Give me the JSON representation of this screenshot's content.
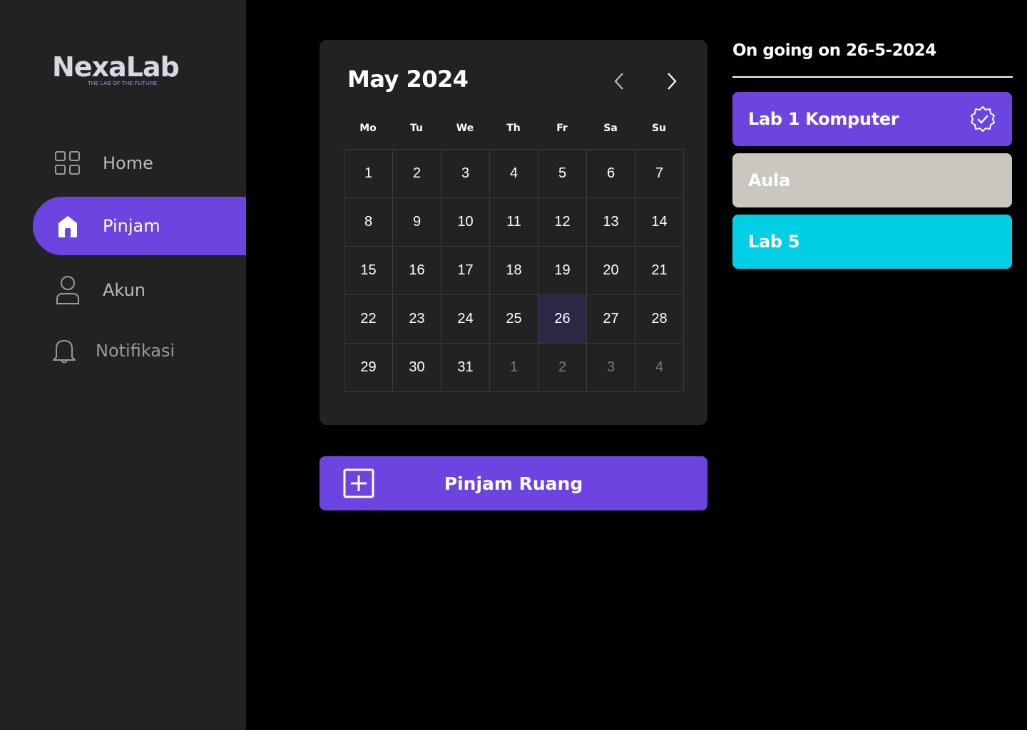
{
  "brand": {
    "name": "NexaLab",
    "tagline": "THE LAB OF THE FUTURE"
  },
  "sidebar": {
    "items": [
      {
        "label": "Home",
        "icon": "grid-icon",
        "active": false
      },
      {
        "label": "Pinjam",
        "icon": "home-icon",
        "active": true
      },
      {
        "label": "Akun",
        "icon": "user-icon",
        "active": false
      },
      {
        "label": "Notifikasi",
        "icon": "bell-icon",
        "active": false
      }
    ]
  },
  "calendar": {
    "title": "May 2024",
    "weekdays": [
      "Mo",
      "Tu",
      "We",
      "Th",
      "Fr",
      "Sa",
      "Su"
    ],
    "days": [
      {
        "d": "1",
        "m": false
      },
      {
        "d": "2",
        "m": false
      },
      {
        "d": "3",
        "m": false
      },
      {
        "d": "4",
        "m": false
      },
      {
        "d": "5",
        "m": false
      },
      {
        "d": "6",
        "m": false
      },
      {
        "d": "7",
        "m": false
      },
      {
        "d": "8",
        "m": false
      },
      {
        "d": "9",
        "m": false
      },
      {
        "d": "10",
        "m": false
      },
      {
        "d": "11",
        "m": false
      },
      {
        "d": "12",
        "m": false
      },
      {
        "d": "13",
        "m": false
      },
      {
        "d": "14",
        "m": false
      },
      {
        "d": "15",
        "m": false
      },
      {
        "d": "16",
        "m": false
      },
      {
        "d": "17",
        "m": false
      },
      {
        "d": "18",
        "m": false
      },
      {
        "d": "19",
        "m": false
      },
      {
        "d": "20",
        "m": false
      },
      {
        "d": "21",
        "m": false
      },
      {
        "d": "22",
        "m": false
      },
      {
        "d": "23",
        "m": false
      },
      {
        "d": "24",
        "m": false
      },
      {
        "d": "25",
        "m": false
      },
      {
        "d": "26",
        "m": false,
        "selected": true
      },
      {
        "d": "27",
        "m": false
      },
      {
        "d": "28",
        "m": false
      },
      {
        "d": "29",
        "m": false
      },
      {
        "d": "30",
        "m": false
      },
      {
        "d": "31",
        "m": false
      },
      {
        "d": "1",
        "m": true
      },
      {
        "d": "2",
        "m": true
      },
      {
        "d": "3",
        "m": true
      },
      {
        "d": "4",
        "m": true
      }
    ]
  },
  "action": {
    "label": "Pinjam Ruang"
  },
  "ongoing": {
    "title": "On going on 26-5-2024",
    "rooms": [
      {
        "label": "Lab 1 Komputer",
        "color": "#6c44e0",
        "verified": true
      },
      {
        "label": "Aula",
        "color": "#cac7c0",
        "verified": false
      },
      {
        "label": "Lab 5",
        "color": "#00cfe6",
        "verified": false
      }
    ]
  },
  "colors": {
    "accent": "#6c44e0",
    "sidebar_bg": "#222222",
    "page_bg": "#000000",
    "selected_day": "#2d2645"
  }
}
